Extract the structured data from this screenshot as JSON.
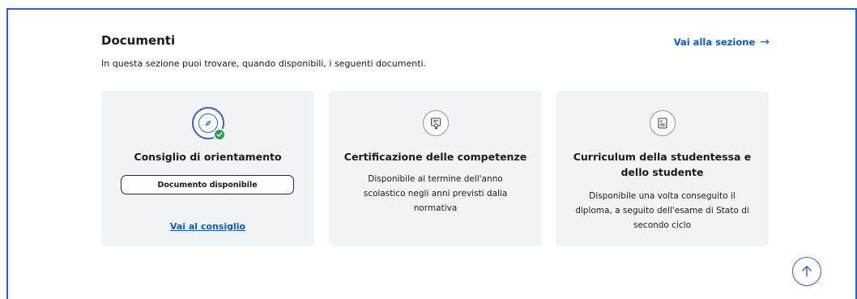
{
  "section": {
    "title": "Documenti",
    "subtitle": "In questa sezione puoi trovare, quando disponibili, i seguenti documenti.",
    "link_label": "Vai alla sezione",
    "link_arrow": "→"
  },
  "cards": [
    {
      "title": "Consiglio di orientamento",
      "icon": "compass-icon",
      "status_badge": "check-icon",
      "button_label": "Documento disponibile",
      "link_label": "Vai al consiglio"
    },
    {
      "title": "Certificazione delle competenze",
      "icon": "certificate-icon",
      "description": "Disponibile al termine dell'anno scolastico negli anni previsti dalla normativa"
    },
    {
      "title": "Curriculum della studentessa e dello studente",
      "icon": "document-list-icon",
      "description": "Disponibile una volta conseguito il diploma, a seguito dell'esame di Stato di secondo ciclo"
    }
  ],
  "back_to_top": {
    "icon": "arrow-up-icon"
  },
  "colors": {
    "accent": "#2f5fd0",
    "link": "#0b57d0",
    "card_bg": "#f2f4f6",
    "success": "#1ea155"
  }
}
